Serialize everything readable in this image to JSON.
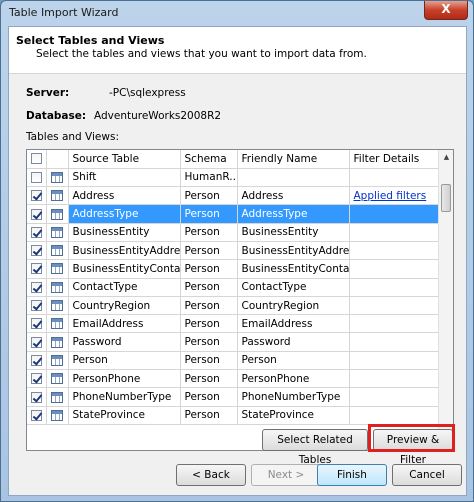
{
  "window": {
    "title": "Table Import Wizard",
    "close_label": "X"
  },
  "header": {
    "title": "Select Tables and Views",
    "subtitle": "Select the tables and views that you want to import data from."
  },
  "server": {
    "label": "Server:",
    "value": "-PC\\sqlexpress"
  },
  "database": {
    "label": "Database:",
    "value": "AdventureWorks2008R2"
  },
  "tables_label": "Tables and Views:",
  "grid": {
    "columns": [
      "Source Table",
      "Schema",
      "Friendly Name",
      "Filter Details"
    ],
    "rows": [
      {
        "checked": false,
        "source": "Shift",
        "schema": "HumanR...",
        "friendly": "",
        "filter": ""
      },
      {
        "checked": true,
        "source": "Address",
        "schema": "Person",
        "friendly": "Address",
        "filter": "Applied filters"
      },
      {
        "checked": true,
        "source": "AddressType",
        "schema": "Person",
        "friendly": "AddressType",
        "filter": "",
        "selected": true
      },
      {
        "checked": true,
        "source": "BusinessEntity",
        "schema": "Person",
        "friendly": "BusinessEntity",
        "filter": ""
      },
      {
        "checked": true,
        "source": "BusinessEntityAddress",
        "schema": "Person",
        "friendly": "BusinessEntityAddress",
        "filter": ""
      },
      {
        "checked": true,
        "source": "BusinessEntityContact",
        "schema": "Person",
        "friendly": "BusinessEntityContact",
        "filter": ""
      },
      {
        "checked": true,
        "source": "ContactType",
        "schema": "Person",
        "friendly": "ContactType",
        "filter": ""
      },
      {
        "checked": true,
        "source": "CountryRegion",
        "schema": "Person",
        "friendly": "CountryRegion",
        "filter": ""
      },
      {
        "checked": true,
        "source": "EmailAddress",
        "schema": "Person",
        "friendly": "EmailAddress",
        "filter": ""
      },
      {
        "checked": true,
        "source": "Password",
        "schema": "Person",
        "friendly": "Password",
        "filter": ""
      },
      {
        "checked": true,
        "source": "Person",
        "schema": "Person",
        "friendly": "Person",
        "filter": ""
      },
      {
        "checked": true,
        "source": "PersonPhone",
        "schema": "Person",
        "friendly": "PersonPhone",
        "filter": ""
      },
      {
        "checked": true,
        "source": "PhoneNumberType",
        "schema": "Person",
        "friendly": "PhoneNumberType",
        "filter": ""
      },
      {
        "checked": true,
        "source": "StateProvince",
        "schema": "Person",
        "friendly": "StateProvince",
        "filter": ""
      }
    ]
  },
  "buttons": {
    "select_related": "Select Related Tables",
    "preview_filter": "Preview & Filter",
    "back": "< Back",
    "next": "Next >",
    "finish": "Finish",
    "cancel": "Cancel"
  },
  "colors": {
    "selection": "#3399ff",
    "highlight": "#e0201c",
    "link": "#0033cc"
  }
}
